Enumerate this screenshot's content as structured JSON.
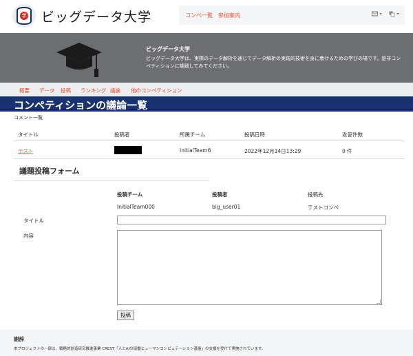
{
  "header": {
    "logo_text": "ビッグデータ大学",
    "logo_seal": "学",
    "nav": [
      {
        "label": "コンペ一覧"
      },
      {
        "label": "参加案内"
      }
    ],
    "icons": [
      "mail-icon",
      "language-icon"
    ]
  },
  "hero": {
    "title": "ビッグデータ大学",
    "description": "ビッグデータ大学は、実際のデータ解析を通じてデータ解析の実践的技術を身に着けるための学びの場です。是非コンペティションに挑戦してみてください。"
  },
  "subnav": {
    "items": [
      {
        "label": "概要"
      },
      {
        "label": "データ"
      },
      {
        "label": "投稿"
      },
      {
        "label": "ランキング"
      },
      {
        "label": "議論"
      },
      {
        "label": "他のコンペティション"
      }
    ]
  },
  "page": {
    "title": "コンペティションの議論一覧",
    "comment_list_label": "コメント一覧"
  },
  "table": {
    "headers": [
      "タイトル",
      "投稿者",
      "所属チーム",
      "投稿日時",
      "返答件数"
    ],
    "rows": [
      {
        "title": "テスト",
        "poster": "",
        "team": "InitialTeam6",
        "date": "2022年12月14日13:29",
        "replies": "0 件"
      }
    ]
  },
  "form": {
    "heading": "議題投稿フォーム",
    "team_label": "投稿チーム",
    "team_value": "InitialTeam000",
    "poster_label": "投稿者",
    "poster_value": "big_user01",
    "dest_label": "投稿先",
    "dest_value": "テストコンペ",
    "title_label": "タイトル",
    "title_value": "",
    "content_label": "内容",
    "content_value": "",
    "submit_label": "投稿"
  },
  "footer": {
    "heading": "謝辞",
    "text": "本プロジェクトの一部は、戦略的創造研究推進事業 CREST「人とAIの協働ヒューマンコンピュテーション基盤」の支援を受けて実施されています。"
  },
  "colors": {
    "accent": "#e4502e",
    "title_bar": "#1a3272",
    "hero_bg": "#6d6e71"
  }
}
